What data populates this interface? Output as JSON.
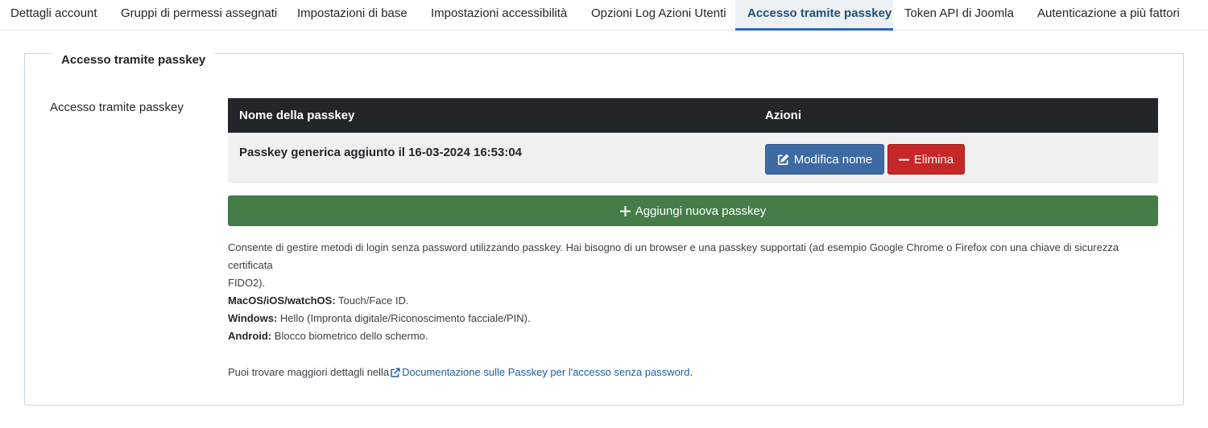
{
  "tabs": [
    {
      "label": "Dettagli account"
    },
    {
      "label": "Gruppi di permessi assegnati"
    },
    {
      "label": "Impostazioni di base"
    },
    {
      "label": "Impostazioni accessibilità"
    },
    {
      "label": "Opzioni Log Azioni Utenti"
    },
    {
      "label": "Accesso tramite passkey",
      "active": true
    },
    {
      "label": "Token API di Joomla"
    },
    {
      "label": "Autenticazione a più fattori"
    }
  ],
  "fieldset": {
    "legend": "Accesso tramite passkey",
    "field_label": "Accesso tramite passkey"
  },
  "table": {
    "headers": {
      "name": "Nome della passkey",
      "actions": "Azioni"
    },
    "rows": [
      {
        "name": "Passkey generica aggiunto il 16-03-2024 16:53:04",
        "edit_label": "Modifica nome",
        "delete_label": "Elimina"
      }
    ]
  },
  "add_button": {
    "label": "Aggiungi nuova passkey",
    "icon": "plus-icon"
  },
  "description": {
    "line1": "Consente di gestire metodi di login senza password utilizzando passkey. Hai bisogno di un browser e una passkey supportati (ad esempio Google Chrome o Firefox con una chiave di sicurezza certificata",
    "line2": "FIDO2).",
    "platforms": [
      {
        "label": "MacOS/iOS/watchOS:",
        "value": "Touch/Face ID."
      },
      {
        "label": "Windows:",
        "value": "Hello (Impronta digitale/Riconoscimento facciale/PIN)."
      },
      {
        "label": "Android:",
        "value": "Blocco biometrico dello schermo."
      }
    ],
    "more_prefix": "Puoi trovare maggiori dettagli nella",
    "more_link": "Documentazione sulle Passkey per l'accesso senza password",
    "more_suffix": "."
  },
  "colors": {
    "active_tab": "#1f4f7c",
    "table_header_bg": "#22262a",
    "edit_button": "#3d6aa3",
    "delete_button": "#c52827",
    "add_button": "#457d49",
    "link": "#1d5fa3"
  }
}
